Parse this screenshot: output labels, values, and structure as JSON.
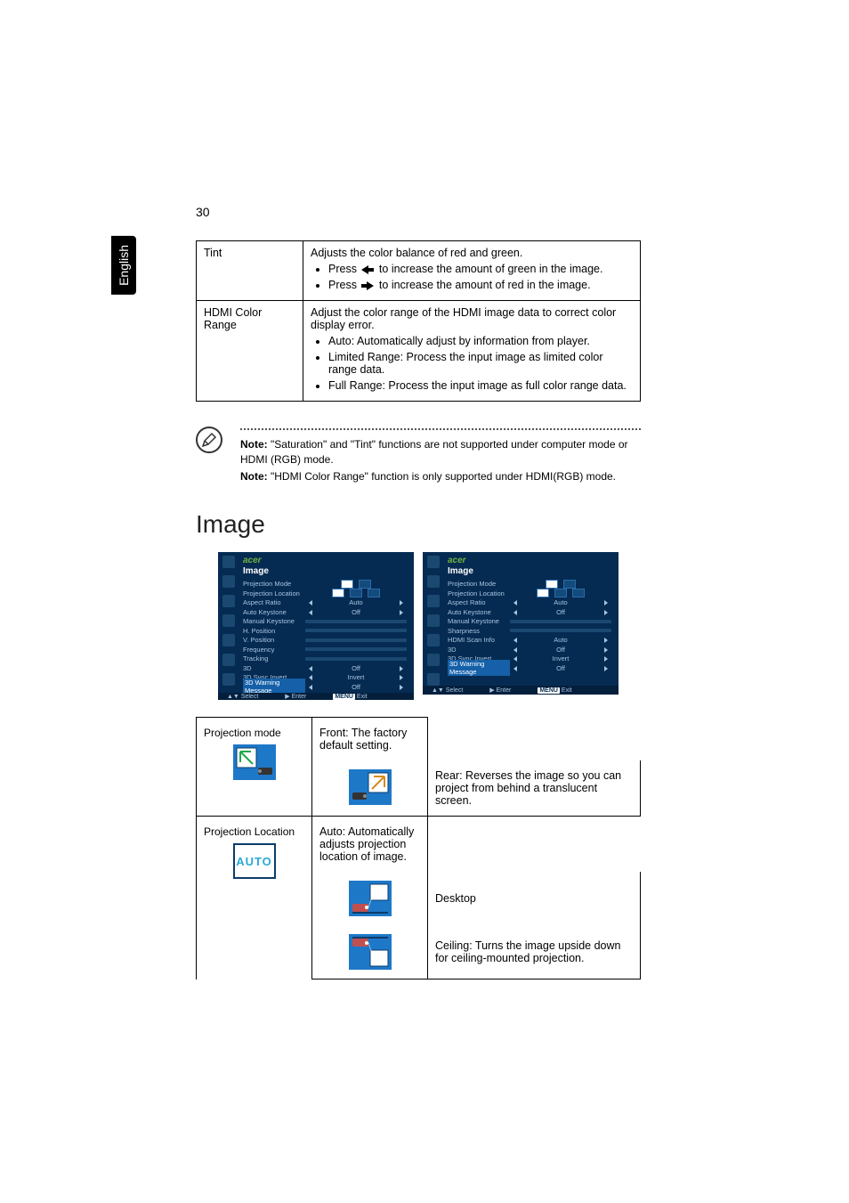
{
  "pageNumber": "30",
  "languageTab": "English",
  "topTable": {
    "tint": {
      "label": "Tint",
      "desc": "Adjusts the color balance of red and green.",
      "greenLine": " to increase the amount of green in the image.",
      "redLine": " to increase the amount of red in the image.",
      "pressWord": "Press "
    },
    "hdmi": {
      "label": "HDMI Color Range",
      "desc": "Adjust the color range of the HDMI image data to correct color display error.",
      "auto": "Auto: Automatically adjust by information from player.",
      "limited": "Limited Range: Process the input image as limited color range data.",
      "full": "Full Range:  Process the input image as full color range data."
    }
  },
  "notes": {
    "noteWord": "Note:",
    "note1": "  \"Saturation\" and \"Tint\" functions are not supported under computer mode or HDMI (RGB) mode.",
    "note2": "  \"HDMI Color Range\" function is only supported under HDMI(RGB) mode."
  },
  "sectionTitle": "Image",
  "osd": {
    "brand": "acer",
    "heading": "Image",
    "footer": {
      "select": "Select",
      "enter": "Enter",
      "menu": "MENU",
      "exit": "Exit"
    },
    "left": {
      "items": [
        {
          "label": "Projection Mode",
          "type": "icons"
        },
        {
          "label": "Projection Location",
          "type": "icons3"
        },
        {
          "label": "Aspect Ratio",
          "type": "val",
          "value": "Auto"
        },
        {
          "label": "Auto Keystone",
          "type": "val",
          "value": "Off"
        },
        {
          "label": "Manual Keystone",
          "type": "slider"
        },
        {
          "label": "H. Position",
          "type": "slider"
        },
        {
          "label": "V. Position",
          "type": "slider"
        },
        {
          "label": "Frequency",
          "type": "slider"
        },
        {
          "label": "Tracking",
          "type": "slider"
        },
        {
          "label": "3D",
          "type": "val",
          "value": "Off"
        },
        {
          "label": "3D Sync Invert",
          "type": "val",
          "value": "Invert"
        },
        {
          "label": "3D Warning Message",
          "type": "val",
          "value": "Off",
          "hl": true
        }
      ]
    },
    "right": {
      "items": [
        {
          "label": "Projection Mode",
          "type": "icons"
        },
        {
          "label": "Projection Location",
          "type": "icons3"
        },
        {
          "label": "Aspect Ratio",
          "type": "val",
          "value": "Auto"
        },
        {
          "label": "Auto Keystone",
          "type": "val",
          "value": "Off"
        },
        {
          "label": "Manual Keystone",
          "type": "slider"
        },
        {
          "label": "Sharpness",
          "type": "slider"
        },
        {
          "label": "HDMI Scan Info",
          "type": "val",
          "value": "Auto"
        },
        {
          "label": "3D",
          "type": "val",
          "value": "Off"
        },
        {
          "label": "3D Sync Invert",
          "type": "val",
          "value": "Invert"
        },
        {
          "label": "3D Warning Message",
          "type": "val",
          "value": "Off",
          "hl": true
        }
      ]
    }
  },
  "projTable": {
    "mode": {
      "label": "Projection mode",
      "front": "Front: The factory default setting.",
      "rear": "Rear: Reverses the image so you can project from behind a translucent screen."
    },
    "location": {
      "label": "Projection Location",
      "autoText": "AUTO",
      "auto": "Auto: Automatically adjusts projection location of image.",
      "desktop": "Desktop",
      "ceiling": "Ceiling: Turns the image upside down for ceiling-mounted projection."
    }
  }
}
